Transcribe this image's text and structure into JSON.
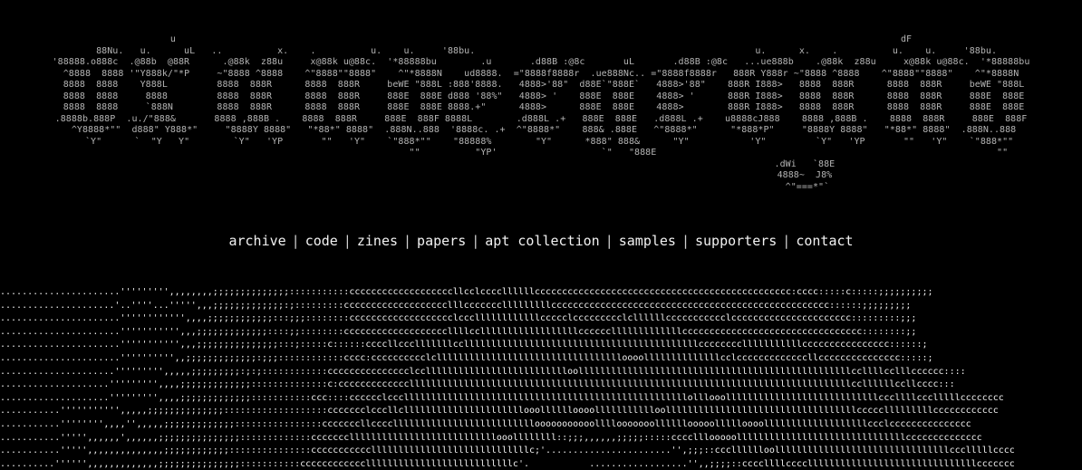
{
  "logo_ascii": "u                                                                                                                                    dF\n  88Nu.   u.      uL   ..          x.    .          u.    u.     '88bu.                                                   u.      x.    .          u.    u.     '88bu.\n'88888.o888c  .@88b  @88R      .@88k  z88u     x@88k u@88c.  '*88888bu        .u       .d88B :@8c       uL       .d88B :@8c   ...ue888b    .@88k  z88u     x@88k u@88c.  '*88888bu\n^8888  8888 '\"Y888k/\"*P     ~\"8888 ^8888    ^\"8888\"\"8888\"    ^\"*8888N    ud8888.  =\"8888f8888r  .ue888Nc.. =\"8888f8888r   888R Y888r ~\"8888 ^8888    ^\"8888\"\"8888\"    ^\"*8888N\n 8888  8888    Y888L         8888  888R      8888  888R     beWE \"888L :888'8888.   4888>'88\"  d88E`\"888E`   4888>'88\"    888R I888>   8888  888R      8888  888R     beWE \"888L\n 8888  8888     8888         8888  888R      8888  888R     888E  888E d888 '88%\"   4888> '    888E  888E    4888> '      888R I888>   8888  888R      8888  888R     888E  888E\n 8888  8888     `888N        8888  888R      8888  888R     888E  888E 8888.+\"      4888>      888E  888E    4888>        888R I888>   8888  888R      8888  888R     888E  888E\n.8888b.888P  .u./\"888&       8888 ,888B .    8888  888R     888E  888F 8888L        .d888L .+   888E  888E   .d888L .+    u8888cJ888    8888 ,888B .    8888  888R     888E  888F\n ^Y8888*\"\"  d888\" Y888*\"     \"8888Y 8888\"   \"*88*\" 8888\"  .888N..888  '8888c. .+  ^\"8888*\"    888& .888E   ^\"8888*\"      \"*888*P\"     \"8888Y 8888\"   \"*88*\" 8888\"  .888N..888\n   `Y\"      `  \"Y   Y\"        `Y\"   'YP       \"\"   'Y\"    `\"888*\"\"    \"88888%        \"Y\"      *888\" 888&      \"Y\"           'Y\"         `Y\"   'YP       \"\"   'Y\"    `\"888*\"\"\n                                                             \"\"          \"YP'                   `\"   \"888E                                                              \"\"\n                                                                                                .dWi   `88E\n                                                                                                4888~  J8%\n                                                                                                 ^\"===*\"`",
  "nav": {
    "archive": "archive",
    "code": "code",
    "zines": "zines",
    "papers": "papers",
    "apt_collection": "apt collection",
    "samples": "samples",
    "supporters": "supporters",
    "contact": "contact",
    "separator": "|"
  },
  "art_ascii": "......................''''''''',,,,,,,,;;;;;;;;;;;;;;:::::::::::cccccccccccccccccccllcclccccllllllccccccccccccccccccccccccccccccccccccccccccccccc:cccc:::::c:::::;;;;;;;;;;\n.....................'..''''...''''',,,;;;;;;;;;;;;;:;:::::::::ccccccccccccccccccclllccccccclllllllllccccccccccccccccccccccccccccccccccccccccccccccccccc::::::;;;;;;;;;\n......................'''''''''''',,,,;;;;;;;;;;;;:::;;;::::::::ccccccccccccccccccclcccllllllllllllccccclccccccccclcllllllccccccccccclcccccccccccccccccccccc:::::::::;;;\n......................''''''''''',,,;;;;;;;;;;;;;::::;;::::::::cccccccccccccccccccllllccllllllllllllllllllcccccclllllllllllllccccccccccccccccccccccccccccccccc::::::::;;\n......................''''''''''',,,;;;;;;;;;;;;;;;:::;:::::c::::::ccccllccclllllllcclllllllllllllllllllllllllllllllllllllllllllcccccccclllllllllllcccccccccccccccc::::::;\n......................'''''''''',,;;;;;;;;;;;;;:;;;::::::::::::cccc:cccccccccclclllllllllllllllllllllllllllllllllloooollllllllllllllcclcccccccccccccllccccccccccccccc:::::;\n.....................''''''''',,,,,;;;;;;;;;:;:;::::::::::::ccccccccccccccclcclllllllllllllllllllllllllloollllllllllllllllllllllllllllllllllllllllllllllllllccllllcclllcccccc::::\n....................''''''''',,,,;;;;;;;;;;;;;::::::::::::::c:ccccccccccccclllllllllllllllllllllllllllllllllllllllllllllllllllllllllllllllllllllllllllllllllccllllllccllcccc:::\n....................''''''''',,,,;;;;;;;;;;;;;:::::::::::ccc::::cccccclcccllllllllllllllllllllllllllllllllllllllllllllllllllllolllooollllllllllllllllllllllllllllcccllllccclllllcccccccc\n...........''''''''''',,,,,;;;;;;;;;;;;;;:::::::::::::::::::ccccccclcccllcllllllllllllllllllllllooolllllloooollllllllllloolllllllllllllllllllllllllllllllllllccccclllllllllcccccccccccc\n...........'''''''',,,,'',,,,,;;;;;;;;;;;;;::::::::::::::::cccccccllccccllllllllllllllllllllllllllooooooooooollllooooooollllllooooollllloooolllllllllllllllllllccclccccccccccccccc\n...........''''',,,,,,',,,,,,;;;;;;;;;;;;;;;:::::::::::::ccccccclllllllllllllllllllllllllllooollllllll::;;;,,,,,,;;;;;:::::cccclllooooolllllllllllllllllllllllllllllllcccccccccccccc\n...........''''',,,,,,,,,,,,,,;;;;;;;;;;;;:::::::::::::::ccccccccccclllllllllllllllllllllllllllllc;'.......................'',;;;::ccclllllloollllllllllllllllllllllllllllllllccclllllcccc\n..........'''''',,,,,,,,,,,,,;;;;;;;;;;;;;;;:::::::::::cccccccccccclllllllllllllllllllllllllllc'.           ..................'',,;;;;::ccccllllcccclllllllllllllllllllllllllllllllccccccc\n..........''''',,,,,,,,,,,,,,,;;;;;;;;;;;;;;:::::::::::cccccccccccccllllllllllllllllllllllllc'.                          ....',,,;;::::cccllllllllllllllllllllllllllllllllllllllcccc"
}
